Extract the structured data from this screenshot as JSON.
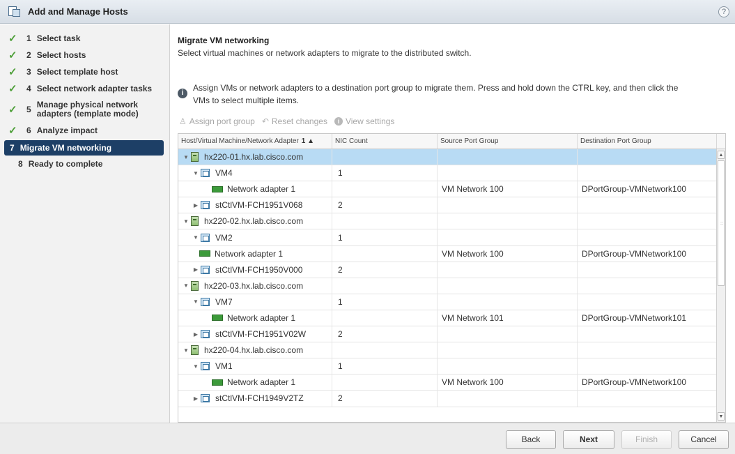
{
  "window": {
    "title": "Add and Manage Hosts",
    "help_glyph": "?"
  },
  "steps": [
    {
      "num": "1",
      "label": "Select task",
      "done": true
    },
    {
      "num": "2",
      "label": "Select hosts",
      "done": true
    },
    {
      "num": "3",
      "label": "Select template host",
      "done": true
    },
    {
      "num": "4",
      "label": "Select network adapter tasks",
      "done": true
    },
    {
      "num": "5",
      "label_line1": "Manage physical network",
      "label_line2": "adapters (template mode)",
      "done": true
    },
    {
      "num": "6",
      "label": "Analyze impact",
      "done": true
    },
    {
      "num": "7",
      "label": "Migrate VM networking",
      "active": true
    },
    {
      "num": "8",
      "label": "Ready to complete"
    }
  ],
  "page": {
    "heading": "Migrate VM networking",
    "subheading": "Select virtual machines or network adapters to migrate to the distributed switch.",
    "info_line1": "Assign VMs or network adapters to a destination port group to migrate them. Press and hold down the CTRL key, and then click the",
    "info_line2": "VMs to select multiple items."
  },
  "toolbar": {
    "assign": "Assign port group",
    "reset": "Reset changes",
    "view": "View settings"
  },
  "grid": {
    "columns": {
      "name": "Host/Virtual Machine/Network Adapter",
      "sort": "1 ▲",
      "nic": "NIC Count",
      "source": "Source Port Group",
      "dest": "Destination Port Group"
    },
    "rows": [
      {
        "kind": "host",
        "expanded": true,
        "name": "hx220-01.hx.lab.cisco.com",
        "nic": "",
        "source": "",
        "dest": "",
        "selected": true
      },
      {
        "kind": "vm",
        "expanded": true,
        "name": "VM4",
        "nic": "1",
        "source": "",
        "dest": ""
      },
      {
        "kind": "nic",
        "name": "Network adapter 1",
        "nic": "",
        "source": "VM Network 100",
        "dest": "DPortGroup-VMNetwork100"
      },
      {
        "kind": "vm",
        "expanded": false,
        "name": "stCtlVM-FCH1951V068",
        "nic": "2",
        "source": "",
        "dest": ""
      },
      {
        "kind": "host",
        "expanded": true,
        "name": "hx220-02.hx.lab.cisco.com",
        "nic": "",
        "source": "",
        "dest": ""
      },
      {
        "kind": "vm",
        "expanded": true,
        "name": "VM2",
        "nic": "1",
        "source": "",
        "dest": ""
      },
      {
        "kind": "nic2",
        "name": "Network adapter 1",
        "nic": "",
        "source": "VM Network 100",
        "dest": "DPortGroup-VMNetwork100"
      },
      {
        "kind": "vm",
        "expanded": false,
        "name": "stCtlVM-FCH1950V000",
        "nic": "2",
        "source": "",
        "dest": ""
      },
      {
        "kind": "host",
        "expanded": true,
        "name": "hx220-03.hx.lab.cisco.com",
        "nic": "",
        "source": "",
        "dest": ""
      },
      {
        "kind": "vm",
        "expanded": true,
        "name": "VM7",
        "nic": "1",
        "source": "",
        "dest": ""
      },
      {
        "kind": "nic",
        "name": "Network adapter 1",
        "nic": "",
        "source": "VM Network 101",
        "dest": "DPortGroup-VMNetwork101"
      },
      {
        "kind": "vm",
        "expanded": false,
        "name": "stCtlVM-FCH1951V02W",
        "nic": "2",
        "source": "",
        "dest": ""
      },
      {
        "kind": "host",
        "expanded": true,
        "name": "hx220-04.hx.lab.cisco.com",
        "nic": "",
        "source": "",
        "dest": ""
      },
      {
        "kind": "vm",
        "expanded": true,
        "name": "VM1",
        "nic": "1",
        "source": "",
        "dest": ""
      },
      {
        "kind": "nic",
        "name": "Network adapter 1",
        "nic": "",
        "source": "VM Network 100",
        "dest": "DPortGroup-VMNetwork100"
      },
      {
        "kind": "vm",
        "expanded": false,
        "name": "stCtlVM-FCH1949V2TZ",
        "nic": "2",
        "source": "",
        "dest": ""
      }
    ]
  },
  "footer": {
    "back": "Back",
    "next": "Next",
    "finish": "Finish",
    "cancel": "Cancel"
  },
  "colors": {
    "accent": "#1d3f66",
    "check": "#4fa03a",
    "selected_row": "#b8dbf4"
  }
}
